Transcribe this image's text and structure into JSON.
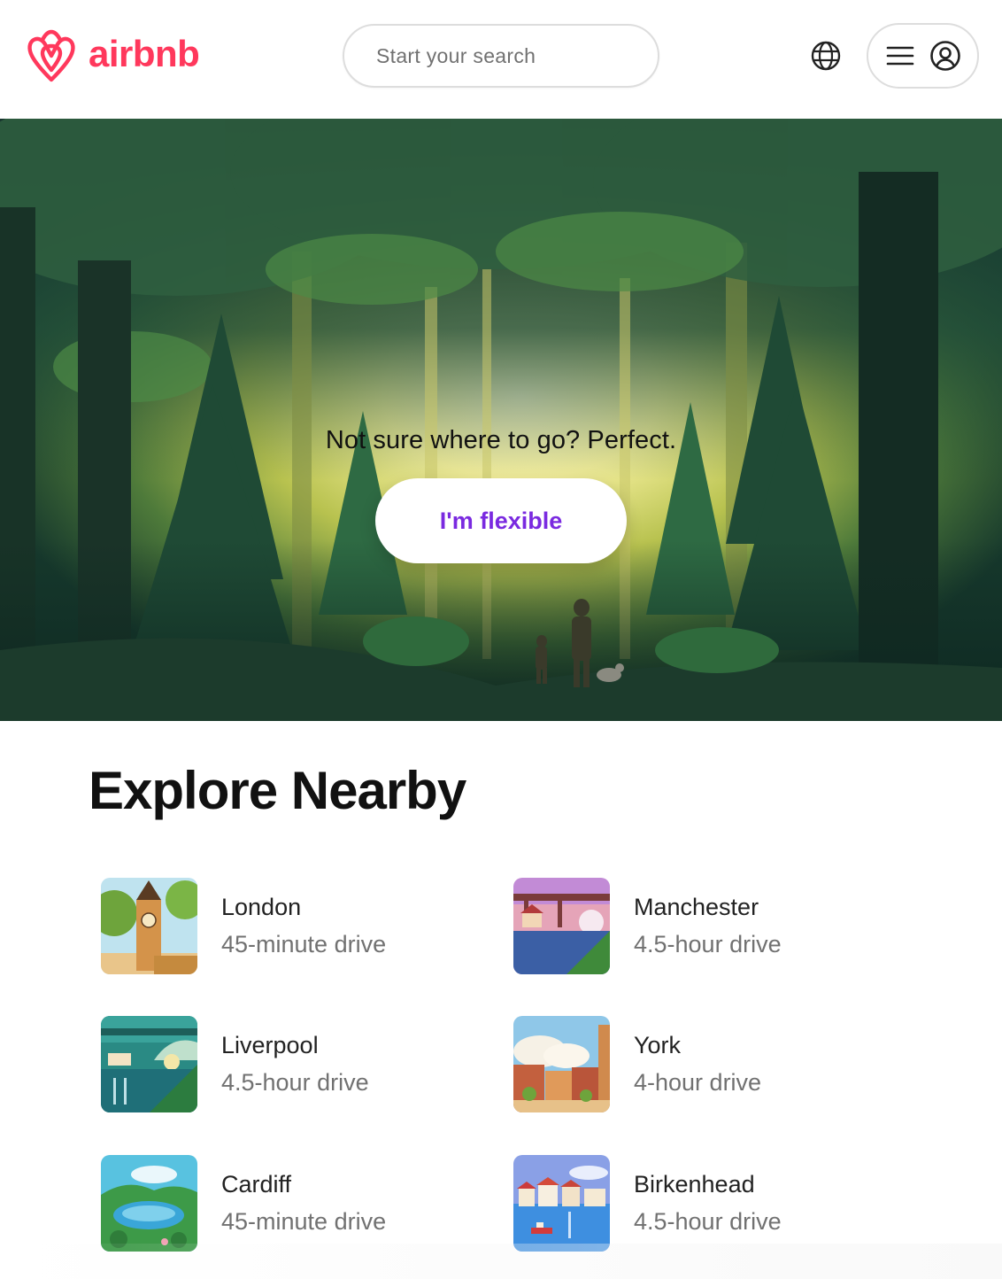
{
  "brand": {
    "name": "airbnb",
    "color": "#FF385C"
  },
  "search": {
    "placeholder": "Start your search"
  },
  "header_icons": {
    "language": "globe-icon",
    "menu": "hamburger-icon",
    "profile": "user-circle-icon"
  },
  "hero": {
    "tagline": "Not sure where to go? Perfect.",
    "button_label": "I'm flexible",
    "button_color": "#7a2ae0"
  },
  "explore": {
    "title": "Explore Nearby",
    "items": [
      {
        "city": "London",
        "drive": "45-minute drive"
      },
      {
        "city": "Manchester",
        "drive": "4.5-hour drive"
      },
      {
        "city": "Liverpool",
        "drive": "4.5-hour drive"
      },
      {
        "city": "York",
        "drive": "4-hour drive"
      },
      {
        "city": "Cardiff",
        "drive": "45-minute drive"
      },
      {
        "city": "Birkenhead",
        "drive": "4.5-hour drive"
      }
    ]
  }
}
